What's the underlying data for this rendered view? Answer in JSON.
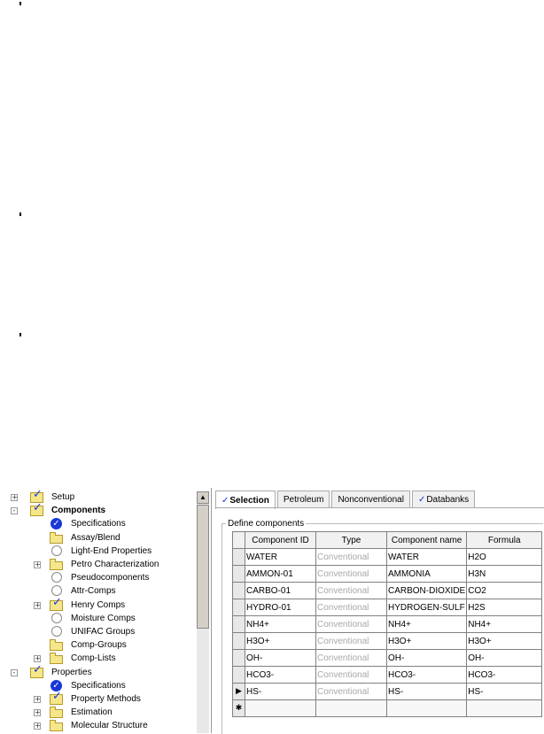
{
  "tree": {
    "items": [
      {
        "label": "Setup",
        "icon": "check-folder-icon",
        "level": 0,
        "expander": "+",
        "bold": false
      },
      {
        "label": "Components",
        "icon": "check-folder-icon",
        "level": 0,
        "expander": "-",
        "bold": true
      },
      {
        "label": "Specifications",
        "icon": "blue-check-icon",
        "level": 1,
        "expander": "",
        "bold": false
      },
      {
        "label": "Assay/Blend",
        "icon": "folder-icon",
        "level": 1,
        "expander": "",
        "bold": false
      },
      {
        "label": "Light-End Properties",
        "icon": "circle-icon",
        "level": 1,
        "expander": "",
        "bold": false
      },
      {
        "label": "Petro Characterization",
        "icon": "folder-icon",
        "level": 1,
        "expander": "+",
        "bold": false
      },
      {
        "label": "Pseudocomponents",
        "icon": "circle-icon",
        "level": 1,
        "expander": "",
        "bold": false
      },
      {
        "label": "Attr-Comps",
        "icon": "circle-icon",
        "level": 1,
        "expander": "",
        "bold": false
      },
      {
        "label": "Henry Comps",
        "icon": "check-folder-icon",
        "level": 1,
        "expander": "+",
        "bold": false
      },
      {
        "label": "Moisture Comps",
        "icon": "circle-icon",
        "level": 1,
        "expander": "",
        "bold": false
      },
      {
        "label": "UNIFAC Groups",
        "icon": "circle-icon",
        "level": 1,
        "expander": "",
        "bold": false
      },
      {
        "label": "Comp-Groups",
        "icon": "folder-icon",
        "level": 1,
        "expander": "",
        "bold": false
      },
      {
        "label": "Comp-Lists",
        "icon": "folder-icon",
        "level": 1,
        "expander": "+",
        "bold": false
      },
      {
        "label": "Properties",
        "icon": "check-folder-icon",
        "level": 0,
        "expander": "-",
        "bold": false
      },
      {
        "label": "Specifications",
        "icon": "blue-check-icon",
        "level": 1,
        "expander": "",
        "bold": false
      },
      {
        "label": "Property Methods",
        "icon": "check-folder-icon",
        "level": 1,
        "expander": "+",
        "bold": false
      },
      {
        "label": "Estimation",
        "icon": "folder-icon",
        "level": 1,
        "expander": "+",
        "bold": false
      },
      {
        "label": "Molecular Structure",
        "icon": "folder-icon",
        "level": 1,
        "expander": "+",
        "bold": false
      }
    ],
    "scroll_up_glyph": "▲"
  },
  "tabs": [
    {
      "label": "Selection",
      "checked": true,
      "active": true
    },
    {
      "label": "Petroleum",
      "checked": false,
      "active": false
    },
    {
      "label": "Nonconventional",
      "checked": false,
      "active": false
    },
    {
      "label": "Databanks",
      "checked": true,
      "active": false
    }
  ],
  "check_glyph": "✓",
  "group_title": "Define components",
  "grid": {
    "columns": [
      "Component ID",
      "Type",
      "Component name",
      "Formula"
    ],
    "rows": [
      {
        "id": "WATER",
        "type": "Conventional",
        "name": "WATER",
        "formula": "H2O",
        "marker": ""
      },
      {
        "id": "AMMON-01",
        "type": "Conventional",
        "name": "AMMONIA",
        "formula": "H3N",
        "marker": ""
      },
      {
        "id": "CARBO-01",
        "type": "Conventional",
        "name": "CARBON-DIOXIDE",
        "formula": "CO2",
        "marker": ""
      },
      {
        "id": "HYDRO-01",
        "type": "Conventional",
        "name": "HYDROGEN-SULF",
        "formula": "H2S",
        "marker": ""
      },
      {
        "id": "NH4+",
        "type": "Conventional",
        "name": "NH4+",
        "formula": "NH4+",
        "marker": ""
      },
      {
        "id": "H3O+",
        "type": "Conventional",
        "name": "H3O+",
        "formula": "H3O+",
        "marker": ""
      },
      {
        "id": "OH-",
        "type": "Conventional",
        "name": "OH-",
        "formula": "OH-",
        "marker": ""
      },
      {
        "id": "HCO3-",
        "type": "Conventional",
        "name": "HCO3-",
        "formula": "HCO3-",
        "marker": ""
      },
      {
        "id": "HS-",
        "type": "Conventional",
        "name": "HS-",
        "formula": "HS-",
        "marker": "▶"
      }
    ],
    "new_row_marker": "✱"
  }
}
